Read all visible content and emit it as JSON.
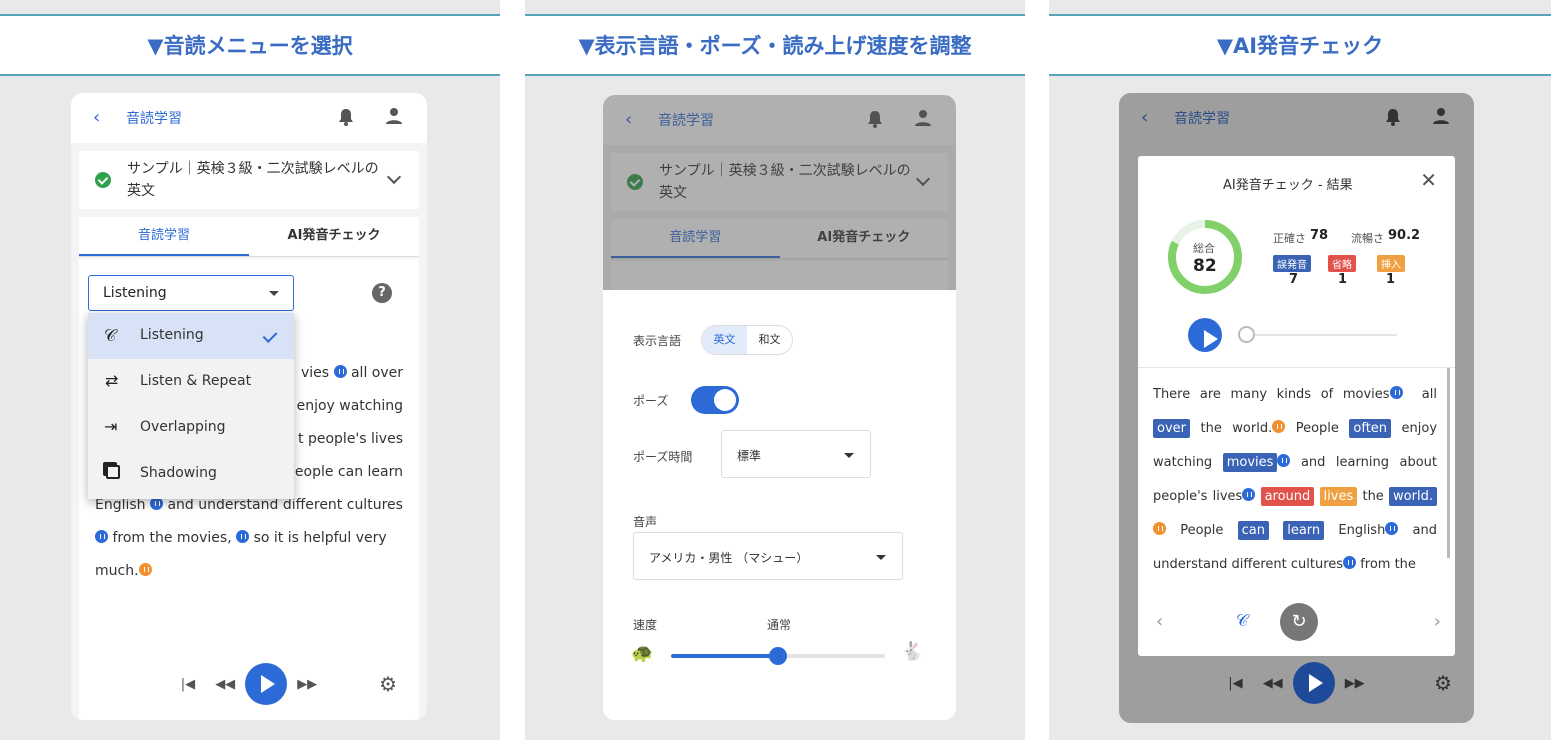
{
  "panels": [
    {
      "header": "▼音読メニューを選択",
      "topbar": {
        "title": "音読学習"
      },
      "course": {
        "title": "サンプル｜英検３級・二次試験レベルの英文"
      },
      "tabs": [
        "音読学習",
        "AI発音チェック"
      ],
      "select_value": "Listening",
      "menu": [
        {
          "label": "Listening",
          "icon": "ear-icon",
          "selected": true
        },
        {
          "label": "Listen & Repeat",
          "icon": "repeat-icon",
          "selected": false
        },
        {
          "label": "Overlapping",
          "icon": "overlap-arrow-icon",
          "selected": false
        },
        {
          "label": "Shadowing",
          "icon": "shadowing-icon",
          "selected": false
        }
      ],
      "text_fragments": {
        "l1a": "vies",
        "l1b": "all over",
        "l2a": "enjoy watching",
        "l3a": "t people's lives",
        "l4a": "eople can learn",
        "l5a": "English",
        "l5b": "and understand different cultures",
        "l6a": "from the movies,",
        "l6b": "so it is helpful very",
        "l7a": "much."
      }
    },
    {
      "header": "▼表示言語・ポーズ・読み上げ速度を調整",
      "topbar": {
        "title": "音読学習"
      },
      "course": {
        "title": "サンプル｜英検３級・二次試験レベルの英文"
      },
      "tabs": [
        "音読学習",
        "AI発音チェック"
      ],
      "settings": {
        "lang_label": "表示言語",
        "lang_options": [
          "英文",
          "和文"
        ],
        "pause_label": "ポーズ",
        "pause_on": true,
        "pause_time_label": "ポーズ時間",
        "pause_time_value": "標準",
        "voice_label": "音声",
        "voice_value": "アメリカ・男性 （マシュー）",
        "speed_label": "速度",
        "speed_value": "通常",
        "speed_fraction": 0.5
      }
    },
    {
      "header": "▼AI発音チェック",
      "topbar": {
        "title": "音読学習"
      },
      "result": {
        "title": "AI発音チェック - 結果",
        "total_label": "総合",
        "total_score": "82",
        "accuracy_label": "正確さ",
        "accuracy": "78",
        "fluency_label": "流暢さ",
        "fluency": "90.2",
        "badges": [
          {
            "label": "誤発音",
            "count": "7",
            "color": "#3a63b6"
          },
          {
            "label": "省略",
            "count": "1",
            "color": "#e0524a"
          },
          {
            "label": "挿入",
            "count": "1",
            "color": "#f0a040"
          }
        ],
        "words": {
          "w1": "There are many kinds of movies",
          "w2": "all",
          "w3": "over",
          "w4": "the world.",
          "w5": "People",
          "w6": "often",
          "w7": "enjoy",
          "w8": "watching",
          "w9": "movies",
          "w10": "and learning about",
          "w11": "people's lives",
          "w12": "around",
          "w13": "lives",
          "w14": "the",
          "w15": "world.",
          "w16": "People",
          "w17": "can",
          "w18": "learn",
          "w19": "English",
          "w20": "and",
          "w21": "understand different cultures",
          "w22": "from the"
        }
      }
    }
  ],
  "colors": {
    "accent": "#2c6ad8",
    "header_border": "#5aa4b9",
    "green": "#2ea24a"
  }
}
